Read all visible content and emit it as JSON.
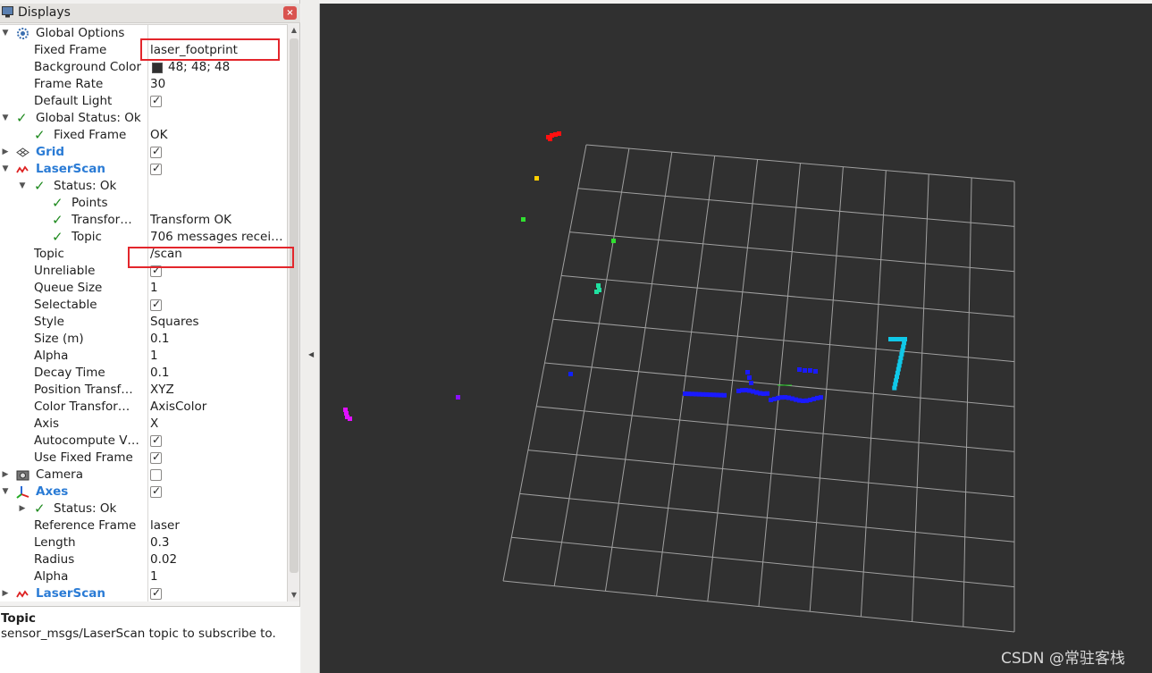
{
  "panel": {
    "title": "Displays",
    "close_label": "×"
  },
  "tree": {
    "global_options": "Global Options",
    "fixed_frame_label": "Fixed Frame",
    "fixed_frame_value": "laser_footprint",
    "background_color_label": "Background Color",
    "background_color_value": "48; 48; 48",
    "frame_rate_label": "Frame Rate",
    "frame_rate_value": "30",
    "default_light_label": "Default Light",
    "global_status_label": "Global Status: Ok",
    "gs_fixed_frame_label": "Fixed Frame",
    "gs_fixed_frame_value": "OK",
    "grid_label": "Grid",
    "laserscan_label": "LaserScan",
    "ls_status_label": "Status: Ok",
    "ls_points_label": "Points",
    "ls_transform_label": "Transfor…",
    "ls_transform_value": "Transform OK",
    "ls_topic_status_label": "Topic",
    "ls_topic_status_value": "706 messages recei…",
    "topic_label": "Topic",
    "topic_value": "/scan",
    "unreliable_label": "Unreliable",
    "queue_size_label": "Queue Size",
    "queue_size_value": "1",
    "selectable_label": "Selectable",
    "style_label": "Style",
    "style_value": "Squares",
    "size_label": "Size (m)",
    "size_value": "0.1",
    "alpha_label": "Alpha",
    "alpha_value": "1",
    "decay_time_label": "Decay Time",
    "decay_time_value": "0.1",
    "position_transformer_label": "Position Transf…",
    "position_transformer_value": "XYZ",
    "color_transformer_label": "Color Transfor…",
    "color_transformer_value": "AxisColor",
    "axis_label": "Axis",
    "axis_value": "X",
    "autocompute_label": "Autocompute V…",
    "use_fixed_frame_label": "Use Fixed Frame",
    "camera_label": "Camera",
    "axes_label": "Axes",
    "axes_status_label": "Status: Ok",
    "reference_frame_label": "Reference Frame",
    "reference_frame_value": "laser",
    "length_label": "Length",
    "length_value": "0.3",
    "radius_label": "Radius",
    "radius_value": "0.02",
    "axes_alpha_label": "Alpha",
    "axes_alpha_value": "1",
    "laserscan2_label": "LaserScan"
  },
  "description": {
    "title": "Topic",
    "text": "sensor_msgs/LaserScan topic to subscribe to."
  },
  "watermark": "CSDN @常驻客栈",
  "colors": {
    "background": "#303030",
    "grid": "#a0a0a0",
    "highlight": "#e3262c",
    "link_blue": "#2a7bd5"
  }
}
